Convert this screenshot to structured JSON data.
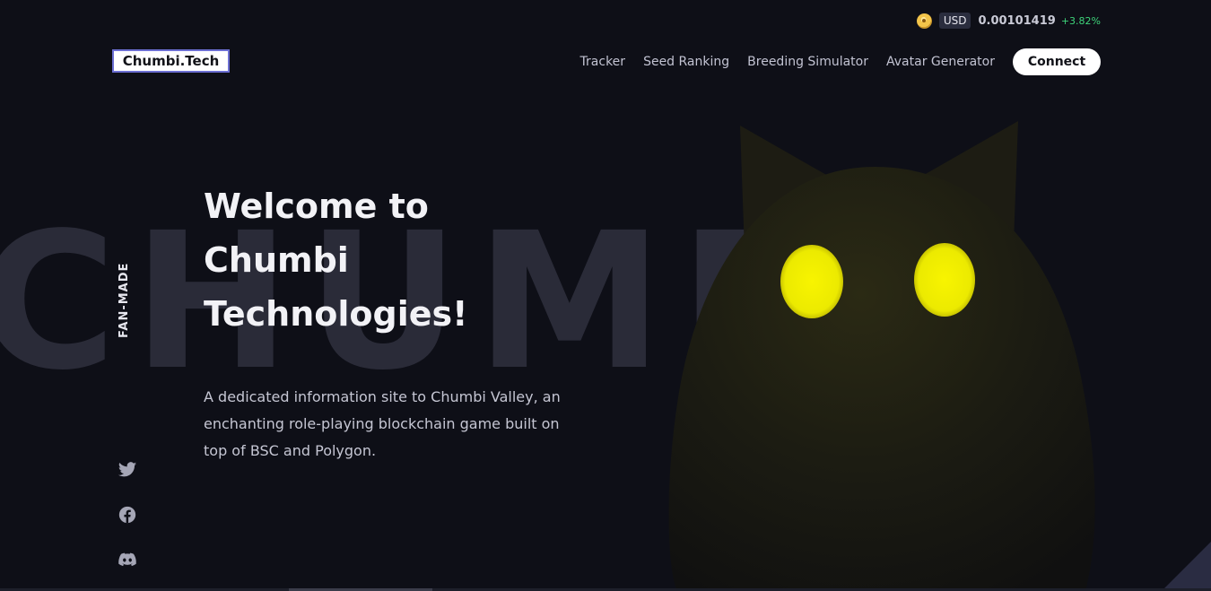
{
  "ticker": {
    "icon": "chmb-coin-icon",
    "currency": "USD",
    "price": "0.00101419",
    "change": "+3.82%",
    "change_color": "#3ed47a"
  },
  "header": {
    "logo": "Chumbi.Tech",
    "nav": [
      {
        "label": "Tracker"
      },
      {
        "label": "Seed Ranking"
      },
      {
        "label": "Breeding Simulator"
      },
      {
        "label": "Avatar Generator"
      }
    ],
    "connect_label": "Connect"
  },
  "hero": {
    "watermark": "CHUMBI",
    "badge": "FAN-MADE",
    "title_line1": "Welcome to",
    "title_line2": "Chumbi",
    "title_line3": "Technologies!",
    "description": "A dedicated information site to Chumbi Valley, an enchanting role-playing blockchain game built on top of BSC and Polygon."
  },
  "social": [
    {
      "icon": "twitter-icon"
    },
    {
      "icon": "facebook-icon"
    },
    {
      "icon": "discord-icon"
    }
  ],
  "colors": {
    "background": "#0e0f17",
    "accent_border": "#6c6fd3",
    "creature_eyes": "#f0ec00"
  }
}
